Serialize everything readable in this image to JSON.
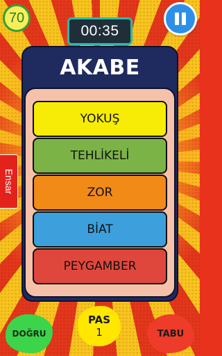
{
  "score": "70",
  "timer": "00:35",
  "card": {
    "title": "AKABE",
    "forbidden_words": [
      "YOKUŞ",
      "TEHLİKELİ",
      "ZOR",
      "BİAT",
      "PEYGAMBER"
    ]
  },
  "side_tab": {
    "label": "Ensar"
  },
  "buttons": {
    "correct": "DOĞRU",
    "pass": "PAS",
    "pass_count": "1",
    "taboo": "TABU"
  },
  "icons": {
    "pause": "pause-icon"
  },
  "colors": {
    "word_1": "#f7ec05",
    "word_2": "#7cb347",
    "word_3": "#f18a16",
    "word_4": "#3d9fdc",
    "word_5": "#e0473c",
    "card_bg": "#1f2a5e",
    "panel_bg": "#f5c2a9"
  }
}
